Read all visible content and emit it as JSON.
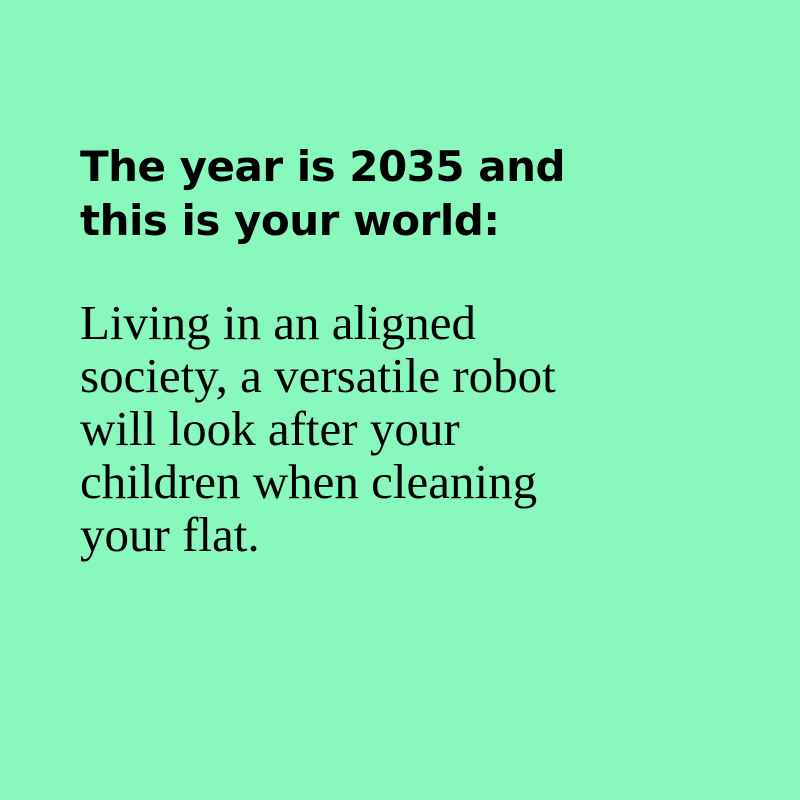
{
  "heading": {
    "lines": [
      "The year is 2035 and",
      "this is your world:"
    ]
  },
  "body": {
    "lines": [
      "Living in an aligned",
      "society, a versatile robot",
      "will look after your",
      "children when cleaning",
      "your flat."
    ]
  },
  "colors": {
    "background": "#88f8bd",
    "text": "#000000"
  }
}
